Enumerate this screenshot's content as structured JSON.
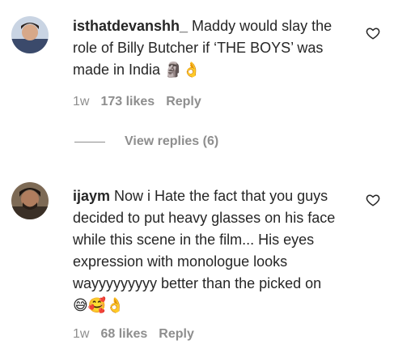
{
  "comments": [
    {
      "username": "isthatdevanshh_",
      "text": " Maddy would slay the role of Billy Butcher if ‘THE BOYS’ was made in India",
      "emojis": "🗿👌",
      "time": "1w",
      "likes": "173 likes",
      "reply": "Reply"
    },
    {
      "username": "ijaym",
      "text": " Now i Hate the fact that you guys decided to put heavy glasses on his face while this scene in the film... His eyes expression with monologue looks wayyyyyyyyy better than the picked on",
      "emojis": "😅🥰👌",
      "time": "1w",
      "likes": "68 likes",
      "reply": "Reply"
    }
  ],
  "view_replies": "View replies (6)",
  "colors": {
    "text": "#262626",
    "muted": "#8e8e8e"
  }
}
